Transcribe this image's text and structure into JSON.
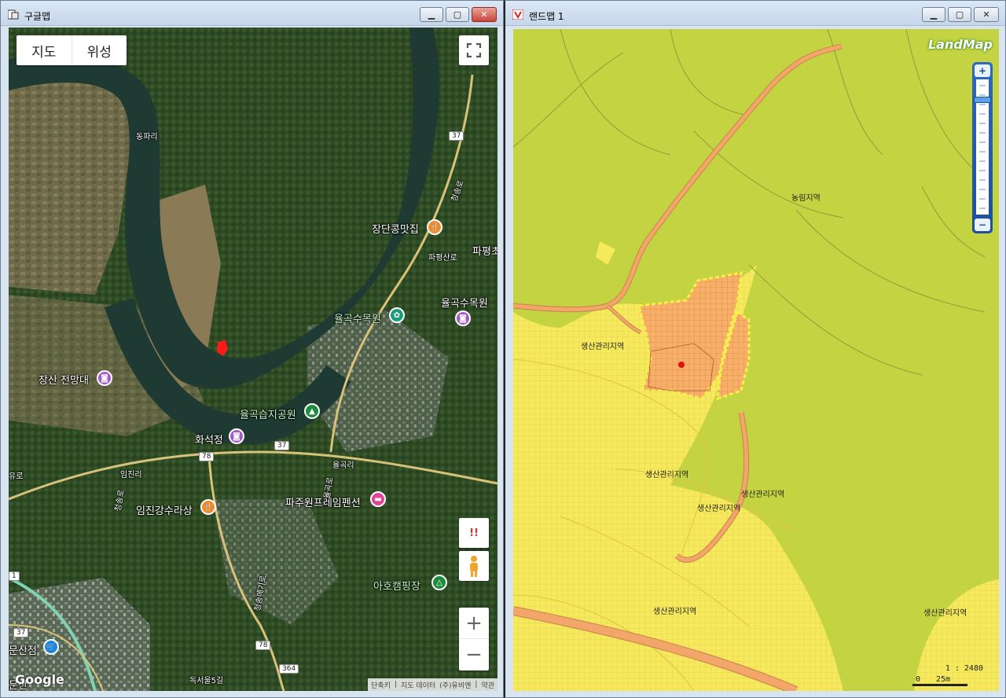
{
  "left_window": {
    "title": "구글맵",
    "map_type": {
      "map_label": "지도",
      "satellite_label": "위성"
    },
    "controls": {
      "alert_label": "!!",
      "zoom_in": "+",
      "zoom_out": "−"
    },
    "roads": [
      "37",
      "37",
      "78",
      "78",
      "364",
      "37",
      "1"
    ],
    "pois": [
      {
        "name": "장단콩맛집"
      },
      {
        "name": "파평초"
      },
      {
        "name": "파평산로"
      },
      {
        "name": "율곡수목원"
      },
      {
        "name": "율곡수목원"
      },
      {
        "name": "장산 전망대"
      },
      {
        "name": "율곡습지공원"
      },
      {
        "name": "화석정"
      },
      {
        "name": "임진리"
      },
      {
        "name": "율곡리"
      },
      {
        "name": "임진강수라상"
      },
      {
        "name": "파주원프레임펜션"
      },
      {
        "name": "아호캠핑장"
      },
      {
        "name": "문산점"
      },
      {
        "name": "동파리"
      },
      {
        "name": "청송로"
      },
      {
        "name": "청송로"
      },
      {
        "name": "청송메기로"
      },
      {
        "name": "독서울5길"
      },
      {
        "name": "문산"
      },
      {
        "name": "유로"
      },
      {
        "name": "율곡로"
      }
    ],
    "attribution": {
      "brand": "Google",
      "shortcuts": "단축키",
      "map_data": "지도 데이터",
      "company": "(주)유비엔",
      "terms": "약관"
    },
    "colors": {
      "marker": "#ff1a1a"
    }
  },
  "right_window": {
    "title": "랜드맵 1",
    "logo": "LandMap",
    "zones": [
      {
        "label": "농림지역"
      },
      {
        "label": "생산관리지역"
      },
      {
        "label": "생산관리지역"
      },
      {
        "label": "생산관리지역"
      },
      {
        "label": "생산관리지역"
      },
      {
        "label": "생산관리지역"
      },
      {
        "label": "생산관리지역"
      }
    ],
    "zoom": {
      "in": "+",
      "out": "−"
    },
    "scale": {
      "ratio": "1 : 2480",
      "zero": "0",
      "distance": "25m"
    },
    "colors": {
      "forest": "#c4d341",
      "production": "#f5ea5b",
      "parcel": "#f6b06a",
      "road": "#f2a66a"
    }
  }
}
